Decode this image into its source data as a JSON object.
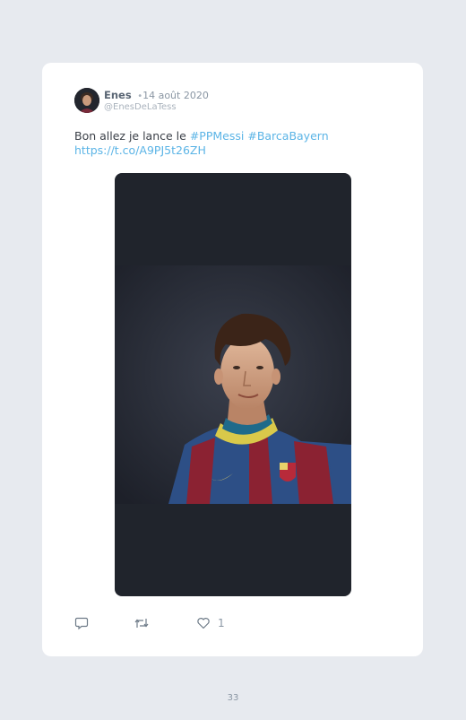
{
  "tweet": {
    "author_name": "Enes",
    "separator": "•",
    "date": "14 août 2020",
    "handle": "@EnesDeLaTess",
    "text_plain": "Bon allez je lance le ",
    "hashtags": [
      "#PPMessi",
      "#BarcaBayern"
    ],
    "link": "https://t.co/A9PJ5t26ZH",
    "media_icon": "photo-of-football-player",
    "like_count": "1",
    "accent_color": "#5bb4e6"
  },
  "actions": {
    "reply_icon": "reply-icon",
    "retweet_icon": "retweet-icon",
    "like_icon": "heart-icon"
  },
  "page": {
    "number": "33"
  }
}
